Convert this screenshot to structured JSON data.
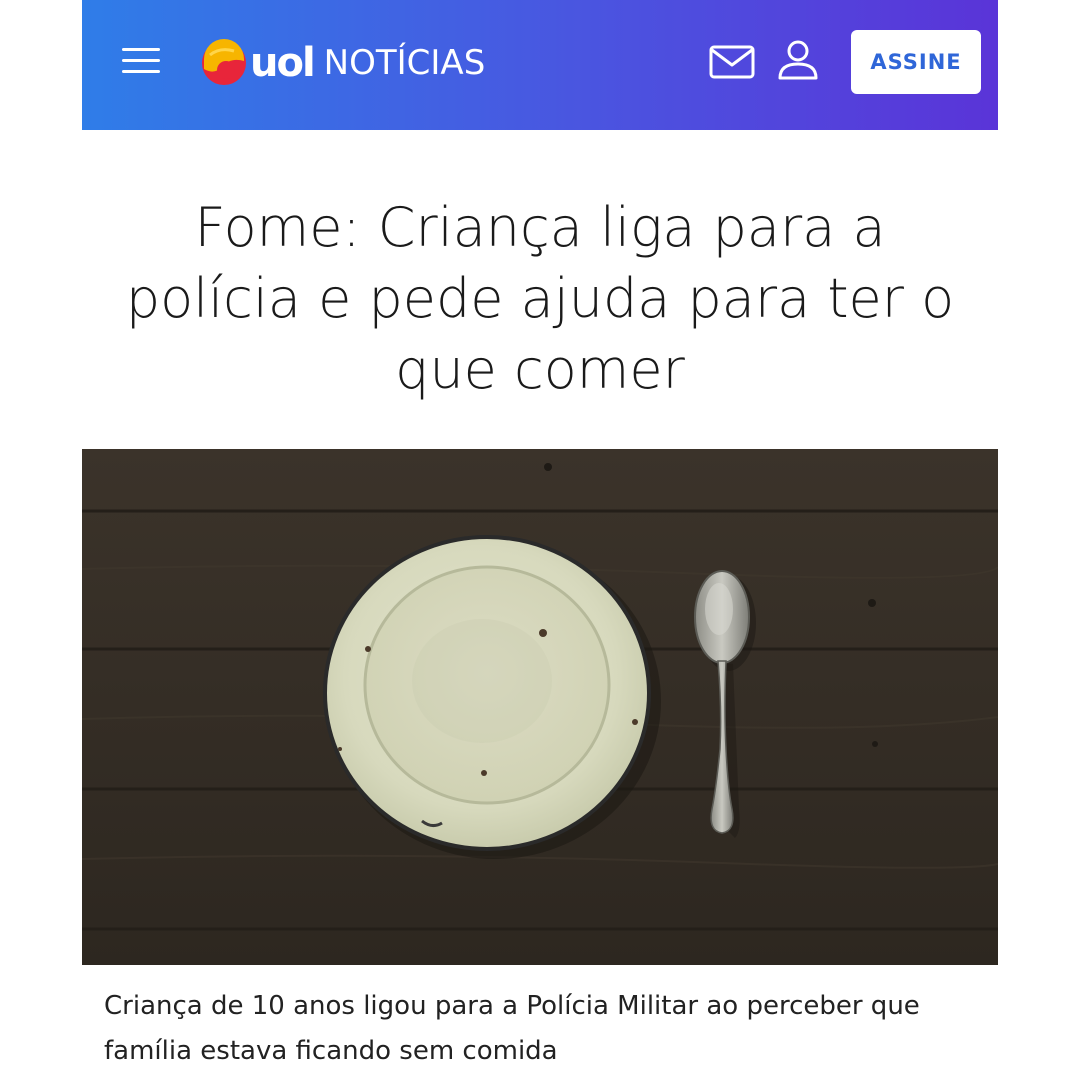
{
  "header": {
    "brand": "uol",
    "section": "NOTÍCIAS",
    "subscribe_label": "ASSINE",
    "menu_icon": "hamburger-menu-icon",
    "mail_icon": "envelope-icon",
    "user_icon": "user-icon"
  },
  "article": {
    "title": "Fome: Criança liga para a polícia e pede ajuda para ter o que comer",
    "image_icon": "empty-plate-and-spoon-photo",
    "caption": "Criança de 10 anos ligou para a Polícia Militar ao perceber que família estava ficando sem comida"
  },
  "colors": {
    "header_start": "#2f7de8",
    "header_end": "#5a34d8",
    "button_text": "#2f66d8",
    "logo_yellow": "#f7b500",
    "logo_red": "#e8253a"
  }
}
